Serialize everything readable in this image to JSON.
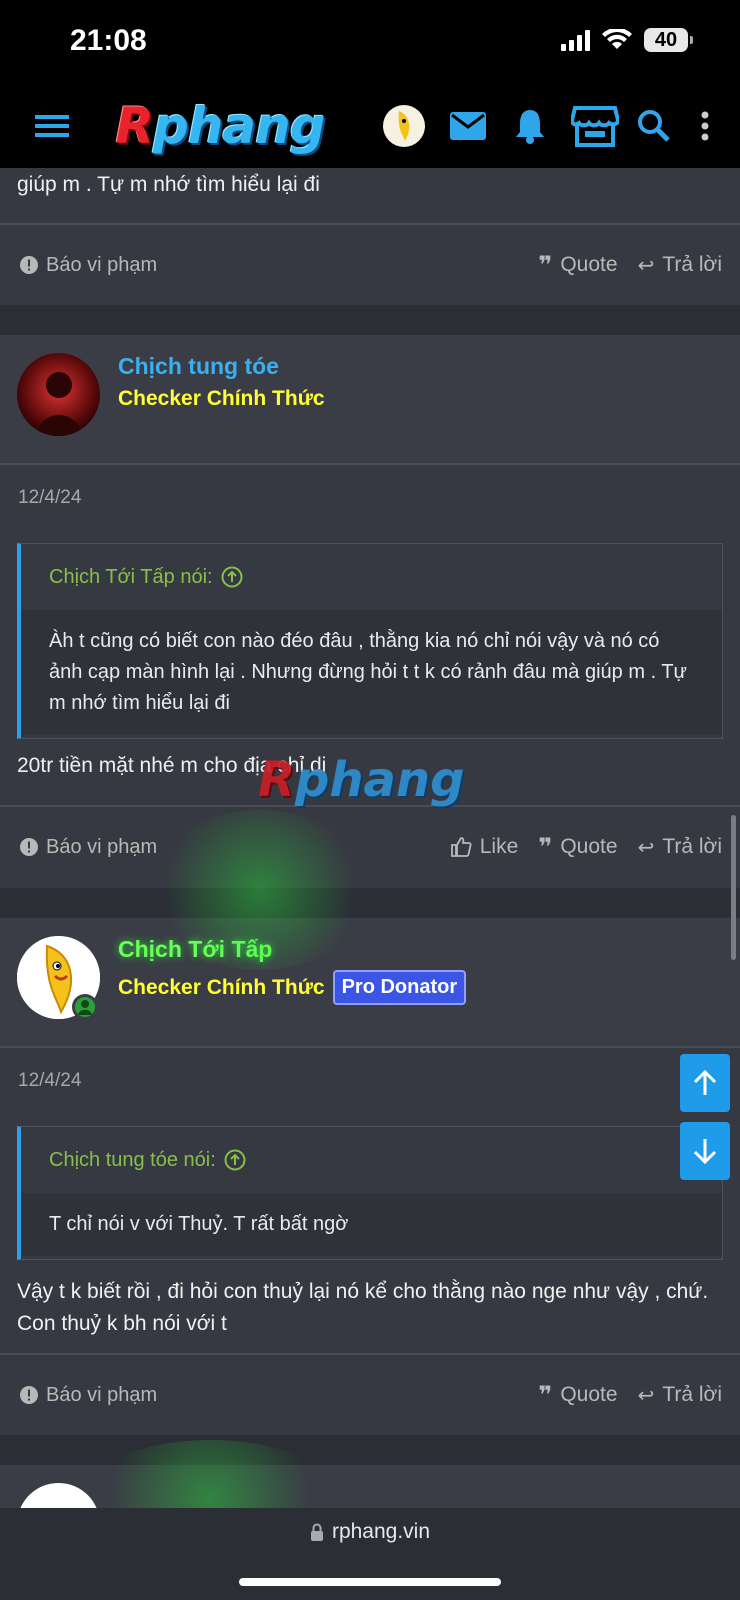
{
  "status": {
    "time": "21:08",
    "battery": "40"
  },
  "nav": {
    "logo_r": "R",
    "logo_rest": "phang",
    "menu_icon": "hamburger-menu-icon",
    "icons": [
      "avatar",
      "mail-icon",
      "bell-icon",
      "store-icon",
      "search-icon",
      "more-vertical-icon"
    ]
  },
  "top_post": {
    "text_tail": "giúp m . Tự m nhớ tìm hiểu lại đi",
    "report": "Báo vi phạm",
    "quote": "Quote",
    "reply": "Trả lời"
  },
  "posts": [
    {
      "username": "Chịch tung tóe",
      "username_color": "#3bb0f0",
      "title": "Checker Chính Thức",
      "date": "12/4/24",
      "quote_author": "Chịch Tới Tấp nói:",
      "quote_text": "Àh t cũng có biết con nào đéo đâu , thằng kia nó chỉ nói vậy và nó có ảnh cạp màn hình lại . Nhưng đừng hỏi t t k có rảnh đâu mà giúp m . Tự m nhớ tìm hiểu lại đi",
      "body": "20tr tiền mặt nhé m cho địa chỉ di",
      "report": "Báo vi phạm",
      "like": "Like",
      "quote": "Quote",
      "reply": "Trả lời"
    },
    {
      "username": "Chịch Tới Tấp",
      "username_color": "#6cff5a",
      "title": "Checker Chính Thức",
      "badge": "Pro Donator",
      "date": "12/4/24",
      "quote_author": "Chịch tung tóe nói:",
      "quote_text": "T chỉ nói v với Thuỷ. T rất bất ngờ",
      "body": "Vậy t k biết rồi , đi hỏi con thuỷ lại nó kể cho thằng nào nge như vậy , chứ. Con thuỷ k bh nói với t",
      "report": "Báo vi phạm",
      "quote": "Quote",
      "reply": "Trả lời"
    }
  ],
  "watermark": {
    "r": "R",
    "rest": "phang"
  },
  "url": "rphang.vin"
}
